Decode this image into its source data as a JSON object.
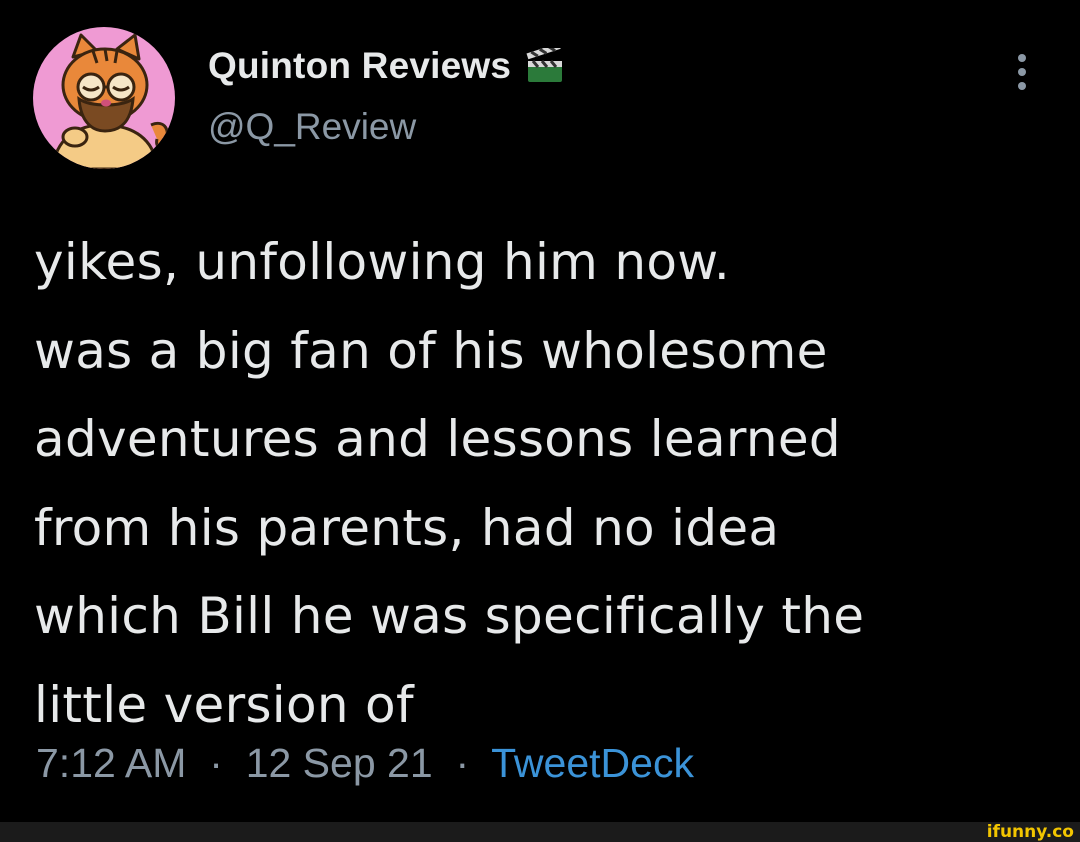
{
  "tweet": {
    "author": {
      "display_name": "Quinton Reviews",
      "handle": "@Q_Review",
      "avatar_icon": "garfield-avatar-icon",
      "badge_icon": "clapper-board-icon"
    },
    "menu_icon": "more-vertical-icon",
    "text_lines": [
      "yikes, unfollowing him now.",
      "was a big fan of his wholesome",
      "adventures and lessons learned",
      "from his parents, had no idea",
      "which Bill he was specifically the",
      "little version of"
    ],
    "time": "7:12 AM",
    "separator": "·",
    "date": "12 Sep 21",
    "source": "TweetDeck"
  },
  "watermark": {
    "text": "ifunny.co"
  },
  "colors": {
    "background": "#000000",
    "text": "#e7e9ea",
    "secondary": "#8b98a5",
    "link": "#3b93d8",
    "watermark": "#f2c500",
    "avatar_bg": "#ef9ad3"
  }
}
